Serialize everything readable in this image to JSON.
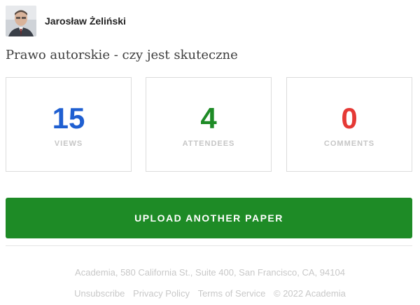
{
  "author": {
    "name": "Jarosław Żeliński",
    "avatar_icon": "author-portrait"
  },
  "paper": {
    "title": "Prawo autorskie - czy jest skuteczne"
  },
  "stats": [
    {
      "value": "15",
      "label": "VIEWS",
      "color": "#1f5fd1"
    },
    {
      "value": "4",
      "label": "ATTENDEES",
      "color": "#1e8b26"
    },
    {
      "value": "0",
      "label": "COMMENTS",
      "color": "#e53935"
    }
  ],
  "upload_button": {
    "label": "UPLOAD ANOTHER PAPER",
    "color": "#1e8b26"
  },
  "footer": {
    "address": "Academia, 580 California St., Suite 400, San Francisco, CA, 94104",
    "links": {
      "unsubscribe": "Unsubscribe",
      "privacy": "Privacy Policy",
      "terms": "Terms of Service"
    },
    "copyright": "© 2022 Academia"
  }
}
